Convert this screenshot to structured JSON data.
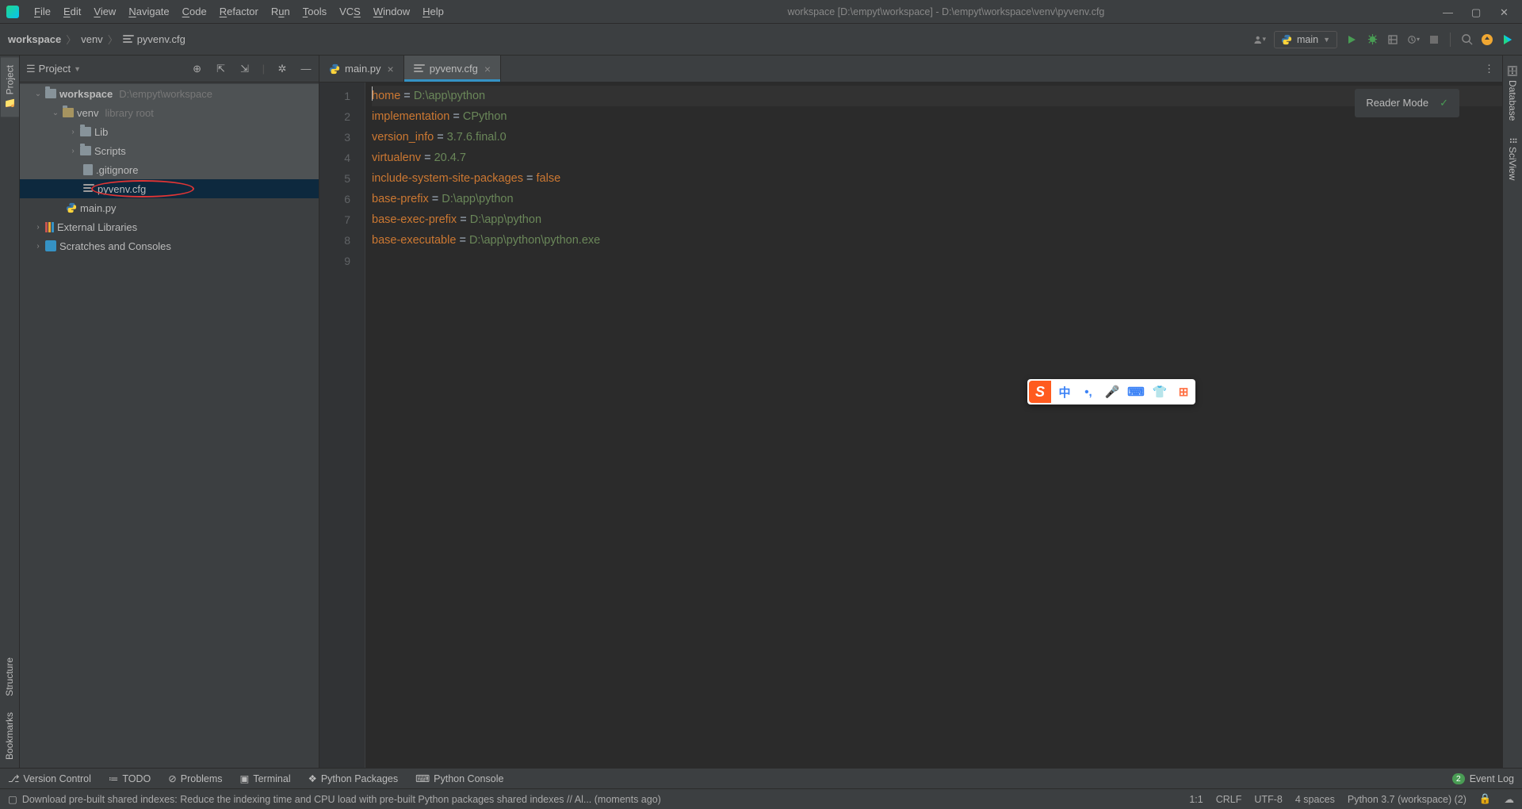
{
  "window": {
    "title": "workspace [D:\\empyt\\workspace] - D:\\empyt\\workspace\\venv\\pyvenv.cfg"
  },
  "menus": [
    "File",
    "Edit",
    "View",
    "Navigate",
    "Code",
    "Refactor",
    "Run",
    "Tools",
    "VCS",
    "Window",
    "Help"
  ],
  "breadcrumbs": {
    "root": "workspace",
    "mid": "venv",
    "file": "pyvenv.cfg"
  },
  "run_config": "main",
  "project_pane": {
    "title": "Project"
  },
  "tree": {
    "root": "workspace",
    "root_path": "D:\\empyt\\workspace",
    "venv": "venv",
    "venv_tag": "library root",
    "lib": "Lib",
    "scripts": "Scripts",
    "gitignore": ".gitignore",
    "pyvenv": "pyvenv.cfg",
    "main": "main.py",
    "ext": "External Libraries",
    "scratch": "Scratches and Consoles"
  },
  "tabs": {
    "main": "main.py",
    "pyvenv": "pyvenv.cfg"
  },
  "reader": "Reader Mode",
  "code": {
    "lines": [
      "1",
      "2",
      "3",
      "4",
      "5",
      "6",
      "7",
      "8",
      "9"
    ],
    "l1k": "home",
    "l1e": " = ",
    "l1v": "D:\\app\\python",
    "l2k": "implementation",
    "l2e": " = ",
    "l2v": "CPython",
    "l3k": "version_info",
    "l3e": " = ",
    "l3v": "3.7.6.final.0",
    "l4k": "virtualenv",
    "l4e": " = ",
    "l4v": "20.4.7",
    "l5k": "include-system-site-packages",
    "l5e": " = ",
    "l5v": "false",
    "l6k": "base-prefix",
    "l6e": " = ",
    "l6v": "D:\\app\\python",
    "l7k": "base-exec-prefix",
    "l7e": " = ",
    "l7v": "D:\\app\\python",
    "l8k": "base-executable",
    "l8e": " = ",
    "l8v": "D:\\app\\python\\python.exe"
  },
  "bottom": {
    "vc": "Version Control",
    "todo": "TODO",
    "prob": "Problems",
    "term": "Terminal",
    "pkg": "Python Packages",
    "cons": "Python Console",
    "evt": "Event Log",
    "evt_n": "2"
  },
  "status": {
    "msg": "Download pre-built shared indexes: Reduce the indexing time and CPU load with pre-built Python packages shared indexes // Al... (moments ago)",
    "pos": "1:1",
    "eol": "CRLF",
    "enc": "UTF-8",
    "indent": "4 spaces",
    "interp": "Python 3.7 (workspace) (2)"
  },
  "left_tabs": {
    "project": "Project",
    "structure": "Structure",
    "bookmarks": "Bookmarks"
  },
  "right_tabs": {
    "db": "Database",
    "sci": "SciView"
  },
  "ime": {
    "cn": "中"
  }
}
